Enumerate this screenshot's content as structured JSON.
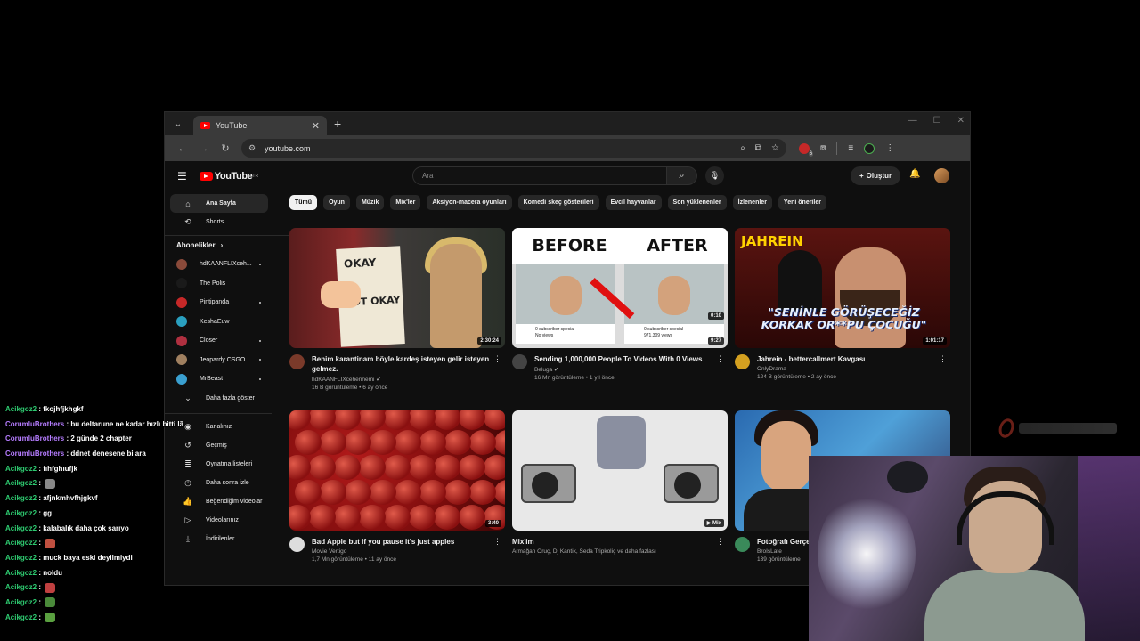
{
  "browser": {
    "tab_title": "YouTube",
    "url": "youtube.com",
    "extension_badge": "6"
  },
  "yt": {
    "logo_text": "YouTube",
    "logo_region": "TR",
    "search_placeholder": "Ara",
    "create_label": "Oluştur"
  },
  "sidebar": {
    "home": "Ana Sayfa",
    "shorts": "Shorts",
    "subscriptions_heading": "Abonelikler",
    "channels": [
      {
        "name": "hdKAANFLIXceh...",
        "color": "#8a4a3a",
        "live": true
      },
      {
        "name": "The Polis",
        "color": "#1a1a1a",
        "live": false
      },
      {
        "name": "Pintipanda",
        "color": "#c62828",
        "live": true
      },
      {
        "name": "KeshaEuw",
        "color": "#2aa0c0",
        "live": false
      },
      {
        "name": "Closer",
        "color": "#b03040",
        "live": true
      },
      {
        "name": "Jeopardy CSGO",
        "color": "#a08060",
        "live": true
      },
      {
        "name": "MrBeast",
        "color": "#3aa0d0",
        "live": true
      }
    ],
    "show_more": "Daha fazla göster",
    "you_items": [
      "Kanalınız",
      "Geçmiş",
      "Oynatma listeleri",
      "Daha sonra izle",
      "Beğendiğim videolar",
      "Videolarınız",
      "İndirilenler"
    ]
  },
  "chips": [
    "Tümü",
    "Oyun",
    "Müzik",
    "Mix'ler",
    "Aksiyon-macera oyunları",
    "Komedi skeç gösterileri",
    "Evcil hayvanlar",
    "Son yüklenenler",
    "İzlenenler",
    "Yeni öneriler"
  ],
  "videos": [
    {
      "title": "Benim karantinam böyle kardeş isteyen gelir isteyen gelmez.",
      "channel": "hdKAANFLIXcehennemi ✔",
      "stats": "16 B görüntüleme • 6 ay önce",
      "duration": "2:30:24",
      "avatar": "#7a3a2a"
    },
    {
      "title": "Sending 1,000,000 People To Videos With 0 Views",
      "channel": "Beluga ✔",
      "stats": "16 Mn görüntüleme • 1 yıl önce",
      "duration": "9:27",
      "avatar": "#444"
    },
    {
      "title": "Jahrein - bettercallmert Kavgası",
      "channel": "OnlyDrama",
      "stats": "124 B görüntüleme • 2 ay önce",
      "duration": "1:01:17",
      "avatar": "#d4a020"
    },
    {
      "title": "Bad Apple but if you pause it's just apples",
      "channel": "Movie Vertigo",
      "stats": "1,7 Mn görüntüleme • 11 ay önce",
      "duration": "3:40",
      "avatar": "#ddd"
    },
    {
      "title": "Mix'im",
      "channel": "Armağan Oruç, Dj Kantik, Seda Tripkoliç ve daha fazlası",
      "stats": "",
      "duration": "▶ Mix",
      "avatar": ""
    },
    {
      "title": "Fotoğrafı Gerçe",
      "channel": "BroIsLate",
      "stats": "139 görüntüleme",
      "duration": "",
      "avatar": "#3a8a5a"
    }
  ],
  "thumb_text": {
    "okay": "OKAY",
    "not_okay": "NOT OKAY",
    "before": "BEFORE",
    "after": "AFTER",
    "sub_special": "0 subscriber special",
    "no_views": "No views",
    "big_views": "971,309 views",
    "small_duration": "0:10",
    "jahrein": "JAHREIN",
    "caption": "\"SENİNLE GÖRÜŞECEĞİZ KORKAK OR**PU ÇOCUĞU\""
  },
  "chat": [
    {
      "user": "Acikgoz2",
      "color": "#2ecc71",
      "msg": "fkojhfjkhgkf"
    },
    {
      "user": "CorumluBrothers",
      "color": "#b57cff",
      "msg": "bu deltarune ne kadar hızlı bitti lã"
    },
    {
      "user": "CorumluBrothers",
      "color": "#b57cff",
      "msg": "2 günde 2 chapter"
    },
    {
      "user": "CorumluBrothers",
      "color": "#b57cff",
      "msg": "ddnet denesene bi ara"
    },
    {
      "user": "Acikgoz2",
      "color": "#2ecc71",
      "msg": "fıhfghıufjk"
    },
    {
      "user": "Acikgoz2",
      "color": "#2ecc71",
      "msg": "",
      "emote": "#888"
    },
    {
      "user": "Acikgoz2",
      "color": "#2ecc71",
      "msg": "afjnkmhvfhjgkvf"
    },
    {
      "user": "Acikgoz2",
      "color": "#2ecc71",
      "msg": "gg"
    },
    {
      "user": "Acikgoz2",
      "color": "#2ecc71",
      "msg": "kalabalık daha çok sarıyo"
    },
    {
      "user": "Acikgoz2",
      "color": "#2ecc71",
      "msg": "",
      "emote": "#c05040"
    },
    {
      "user": "Acikgoz2",
      "color": "#2ecc71",
      "msg": "muck baya eski deyilmiydi"
    },
    {
      "user": "Acikgoz2",
      "color": "#2ecc71",
      "msg": "noldu"
    },
    {
      "user": "Acikgoz2",
      "color": "#2ecc71",
      "msg": "",
      "emote": "#c04040"
    },
    {
      "user": "Acikgoz2",
      "color": "#2ecc71",
      "msg": "",
      "emote": "#4a8a3a"
    },
    {
      "user": "Acikgoz2",
      "color": "#2ecc71",
      "msg": "",
      "emote": "#5aa040"
    }
  ]
}
